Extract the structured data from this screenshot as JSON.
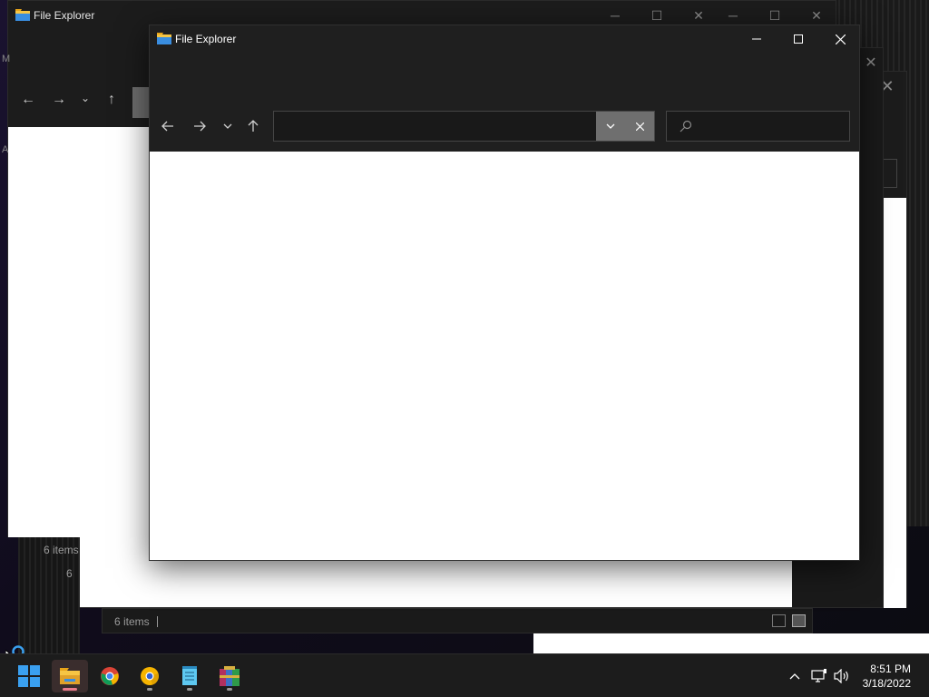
{
  "back_window": {
    "title": "File Explorer",
    "status_count": "6 items",
    "sidebar_letter_m": "M",
    "sidebar_letter_a": "A"
  },
  "middle_window": {
    "status_count": "6 items",
    "status_partial": "6"
  },
  "front_window": {
    "title": "File Explorer",
    "address_value": "",
    "search_placeholder": "",
    "controls": {
      "minimize_icon": "minimize-icon",
      "maximize_icon": "maximize-icon",
      "close_icon": "close-icon"
    }
  },
  "taskbar": {
    "apps": [
      {
        "name": "start",
        "icon": "windows-logo-icon"
      },
      {
        "name": "file-explorer",
        "icon": "folder-icon",
        "active": true
      },
      {
        "name": "chrome",
        "icon": "chrome-icon"
      },
      {
        "name": "chrome-canary",
        "icon": "chrome-canary-icon"
      },
      {
        "name": "notepad",
        "icon": "notepad-icon"
      },
      {
        "name": "winrar",
        "icon": "winrar-icon"
      }
    ],
    "tray": {
      "time": "8:51 PM",
      "date": "3/18/2022"
    }
  },
  "colors": {
    "accent_active": "#e87a8a",
    "indicator_inactive": "#9a9a9a",
    "window_bg": "#1f1f1f",
    "content_bg": "#ffffff",
    "start_blue": "#3aa0f0"
  }
}
